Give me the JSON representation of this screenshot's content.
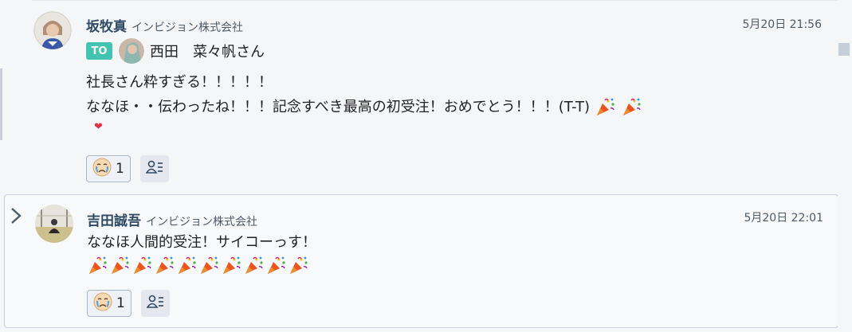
{
  "messages": [
    {
      "sender": "坂牧真",
      "organization": "インビジョン株式会社",
      "timestamp": "5月20日 21:56",
      "to_badge": "TO",
      "to_name": "西田　菜々帆さん",
      "lines": [
        "社長さん粋すぎる！！！！！",
        "ななほ・・伝わったね！！！記念すべき最高の初受注！おめでとう！！！(T-T)"
      ],
      "trailing_icons": [
        "party-popper-icon",
        "party-popper-icon"
      ],
      "extra_icon": "heart-icon",
      "reaction": {
        "icon": "crying-face-icon",
        "count": "1"
      },
      "readers_icon": "readers-icon"
    },
    {
      "sender": "吉田誠吾",
      "organization": "インビジョン株式会社",
      "timestamp": "5月20日 22:01",
      "lines": [
        "ななほ人間的受注！サイコーっす！"
      ],
      "party_popper_count": 10,
      "reaction": {
        "icon": "crying-face-icon",
        "count": "1"
      },
      "readers_icon": "readers-icon",
      "expand_icon": "chevron-right-icon"
    }
  ],
  "colors": {
    "accent_badge": "#43c4b0",
    "name_color": "#2f4a63",
    "heart": "#e2324a"
  }
}
